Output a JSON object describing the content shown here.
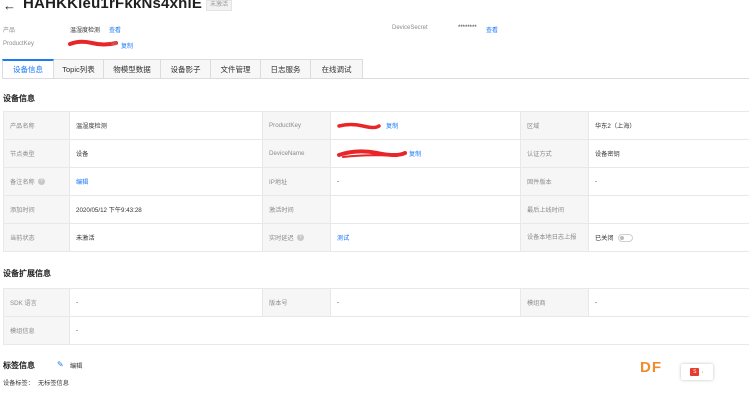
{
  "header": {
    "back_icon": "arrow-left-icon",
    "title": "HAHKKleu1rFkkNs4xhlE",
    "status": "未激活"
  },
  "meta": {
    "product_label": "产品",
    "product_value": "温湿度检测",
    "product_link": "查看",
    "productkey_label": "ProductKey",
    "productkey_visible_suffix": "ss",
    "productkey_copy": "复制",
    "secret_label": "DeviceSecret",
    "secret_value": "********",
    "secret_link": "查看"
  },
  "tabs": [
    {
      "label": "设备信息",
      "active": true
    },
    {
      "label": "Topic列表",
      "active": false
    },
    {
      "label": "物模型数据",
      "active": false
    },
    {
      "label": "设备影子",
      "active": false
    },
    {
      "label": "文件管理",
      "active": false
    },
    {
      "label": "日志服务",
      "active": false
    },
    {
      "label": "在线调试",
      "active": false
    }
  ],
  "device_info": {
    "title": "设备信息",
    "rows": [
      {
        "l1": "产品名称",
        "v1": "温湿度检测",
        "l2": "ProductKey",
        "v2_link": "复制",
        "l3": "区域",
        "v3": "华东2（上海）"
      },
      {
        "l1": "节点类型",
        "v1": "设备",
        "l2": "DeviceName",
        "v2_link": "复制",
        "l3": "认证方式",
        "v3": "设备密钥"
      },
      {
        "l1": "备注名称",
        "v1_link": "编辑",
        "l2": "IP地址",
        "v2": "-",
        "l3": "固件版本",
        "v3": "-"
      },
      {
        "l1": "添加时间",
        "v1": "2020/05/12 下午9:43:28",
        "l2": "激活时间",
        "v2": "",
        "l3": "最后上线时间",
        "v3": ""
      },
      {
        "l1": "当前状态",
        "v1": "未激活",
        "l2": "实时延迟",
        "v2_link": "测试",
        "l3": "设备本地日志上报",
        "v3": "已关闭"
      }
    ]
  },
  "ext_info": {
    "title": "设备扩展信息",
    "rows": [
      {
        "l1": "SDK 语言",
        "v1": "-",
        "l2": "版本号",
        "v2": "-",
        "l3": "模组商",
        "v3": "-"
      },
      {
        "l1": "模组信息",
        "v1": "-"
      }
    ]
  },
  "tag_info": {
    "title": "标签信息",
    "edit_icon": "pencil-icon",
    "edit": "编辑",
    "device_tag_label": "设备标签：",
    "device_tag_value": "无标签信息"
  },
  "watermark": "DF",
  "widget_icon": "sogou-ime-icon",
  "widget_chip": "S",
  "widget_text": "·"
}
